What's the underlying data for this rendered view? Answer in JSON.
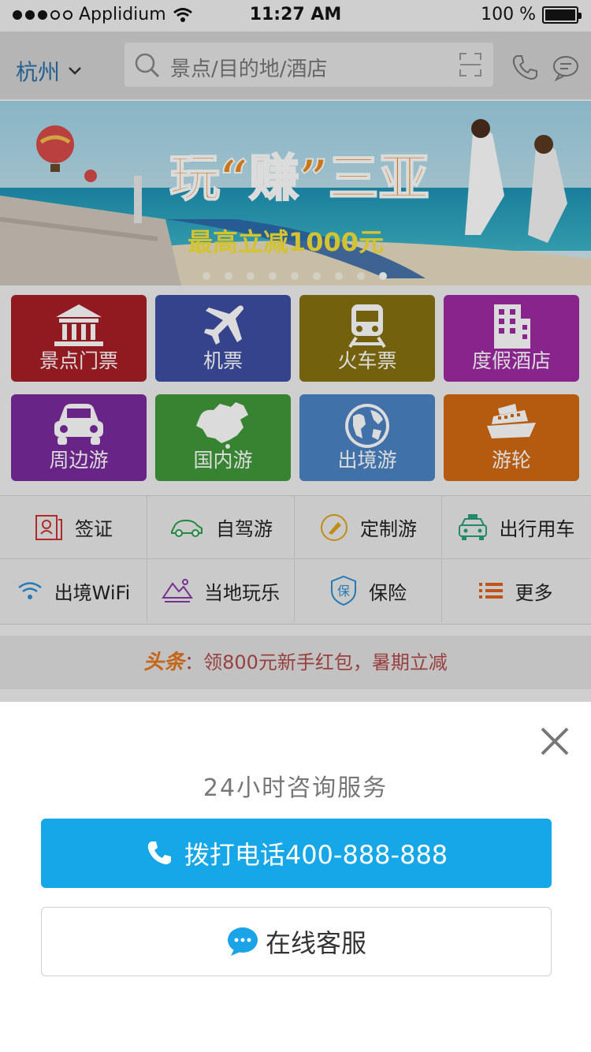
{
  "status_bar": {
    "carrier": "Applidium",
    "time": "11:27 AM",
    "battery": "100 %"
  },
  "header": {
    "city": "杭州",
    "search_placeholder": "景点/目的地/酒店"
  },
  "banner": {
    "headline": "玩“赚”三亚",
    "subline": "最高立减1000元"
  },
  "tiles": [
    {
      "label": "景点门票",
      "color": "#a81f26",
      "icon": "temple-icon"
    },
    {
      "label": "机票",
      "color": "#3e4fa3",
      "icon": "airplane-icon"
    },
    {
      "label": "火车票",
      "color": "#877210",
      "icon": "train-icon"
    },
    {
      "label": "度假酒店",
      "color": "#9f2aa2",
      "icon": "hotel-icon"
    },
    {
      "label": "周边游",
      "color": "#7a2b9e",
      "icon": "car-icon"
    },
    {
      "label": "国内游",
      "color": "#3f9a3a",
      "icon": "china-map-icon"
    },
    {
      "label": "出境游",
      "color": "#4b84c5",
      "icon": "globe-icon"
    },
    {
      "label": "游轮",
      "color": "#d36a12",
      "icon": "cruise-ship-icon"
    }
  ],
  "quick_links": [
    {
      "label": "签证",
      "icon": "passport-icon",
      "color": "#c33"
    },
    {
      "label": "自驾游",
      "icon": "car-outline-icon",
      "color": "#2aa04a"
    },
    {
      "label": "定制游",
      "icon": "custom-tour-icon",
      "color": "#e0a21b"
    },
    {
      "label": "出行用车",
      "icon": "taxi-icon",
      "color": "#2aa07a"
    },
    {
      "label": "出境WiFi",
      "icon": "wifi-icon",
      "color": "#2a8fd0"
    },
    {
      "label": "当地玩乐",
      "icon": "mountain-icon",
      "color": "#8a3aa8"
    },
    {
      "label": "保险",
      "icon": "insurance-shield-icon",
      "color": "#2a8fd0"
    },
    {
      "label": "更多",
      "icon": "list-icon",
      "color": "#e0611b"
    }
  ],
  "news": {
    "tag": "头条",
    "text": "：领800元新手红包，暑期立减"
  },
  "sheet": {
    "title": "24小时咨询服务",
    "call_label": "拨打电话400-888-888",
    "chat_label": "在线客服"
  }
}
